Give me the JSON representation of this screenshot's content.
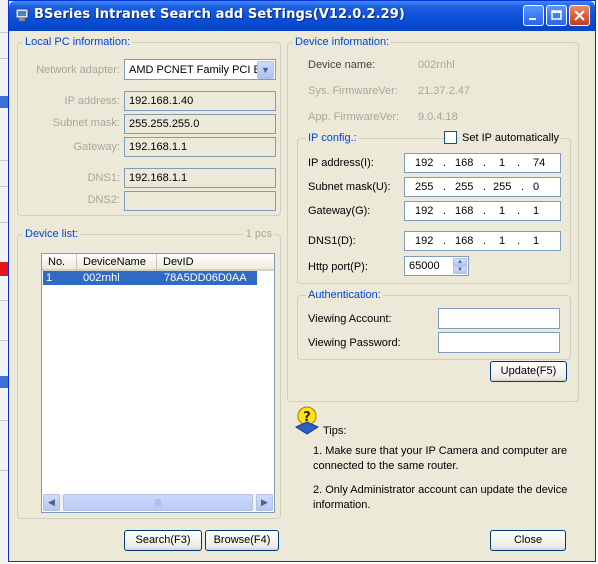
{
  "window": {
    "title": "BSeries Intranet Search add  SetTings(V12.0.2.29)"
  },
  "local_pc": {
    "legend": "Local PC information:",
    "adapter_label": "Network adapter:",
    "adapter_value": "AMD PCNET Family PCI Eth",
    "ip_label": "IP address:",
    "ip_value": "192.168.1.40",
    "mask_label": "Subnet mask:",
    "mask_value": "255.255.255.0",
    "gw_label": "Gateway:",
    "gw_value": "192.168.1.1",
    "dns1_label": "DNS1:",
    "dns1_value": "192.168.1.1",
    "dns2_label": "DNS2:",
    "dns2_value": ""
  },
  "device_list": {
    "legend": "Device list:",
    "count": "1 pcs",
    "columns": [
      "No.",
      "DeviceName",
      "DevID"
    ],
    "rows": [
      {
        "no": "1",
        "name": "002rnhl",
        "id": "78A5DD06D0AA"
      }
    ]
  },
  "device_info": {
    "legend": "Device information:",
    "name_label": "Device name:",
    "name_value": "002rnhl",
    "sys_fw_label": "Sys. FirmwareVer:",
    "sys_fw_value": "21.37.2.47",
    "app_fw_label": "App. FirmwareVer:",
    "app_fw_value": "9.0.4.18"
  },
  "ip_config": {
    "legend": "IP config.:",
    "auto_label": "Set IP automatically",
    "ip_label": "IP address(I):",
    "ip": [
      "192",
      "168",
      "1",
      "74"
    ],
    "mask_label": "Subnet mask(U):",
    "mask": [
      "255",
      "255",
      "255",
      "0"
    ],
    "gw_label": "Gateway(G):",
    "gw": [
      "192",
      "168",
      "1",
      "1"
    ],
    "dns_label": "DNS1(D):",
    "dns": [
      "192",
      "168",
      "1",
      "1"
    ],
    "port_label": "Http port(P):",
    "port_value": "65000"
  },
  "auth": {
    "legend": "Authentication:",
    "account_label": "Viewing Account:",
    "account_value": "",
    "password_label": "Viewing Password:",
    "password_value": ""
  },
  "buttons": {
    "update": "Update(F5)",
    "search": "Search(F3)",
    "browse": "Browse(F4)",
    "close": "Close"
  },
  "tips": {
    "title": "Tips:",
    "tip1": "1. Make sure  that your IP Camera and computer are connected to the same router.",
    "tip2": "2. Only Administrator account can update the device information."
  },
  "colors": {
    "accent": "#0046d5",
    "selection": "#316ac5",
    "titlebar": "#0a4fd8"
  }
}
